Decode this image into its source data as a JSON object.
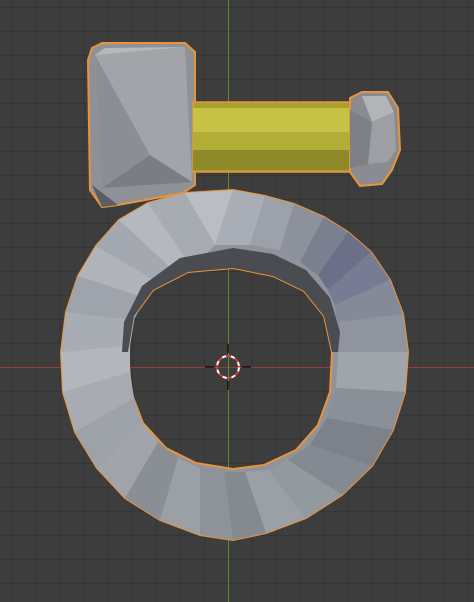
{
  "viewport": {
    "grid_color": "#353535",
    "background_color": "#3d3d3d",
    "x_axis_color": "#9a3b3b",
    "y_axis_color": "#5c8a2d",
    "selection_outline_color": "#e8943a"
  },
  "objects": [
    {
      "name": "ring",
      "selected": true,
      "color": "#8c919a"
    },
    {
      "name": "clasp-head",
      "selected": true,
      "color": "#9a9ca0"
    },
    {
      "name": "clasp-shaft",
      "selected": true,
      "color": "#b8b43a"
    }
  ],
  "cursor": {
    "type": "3d-cursor-icon"
  }
}
